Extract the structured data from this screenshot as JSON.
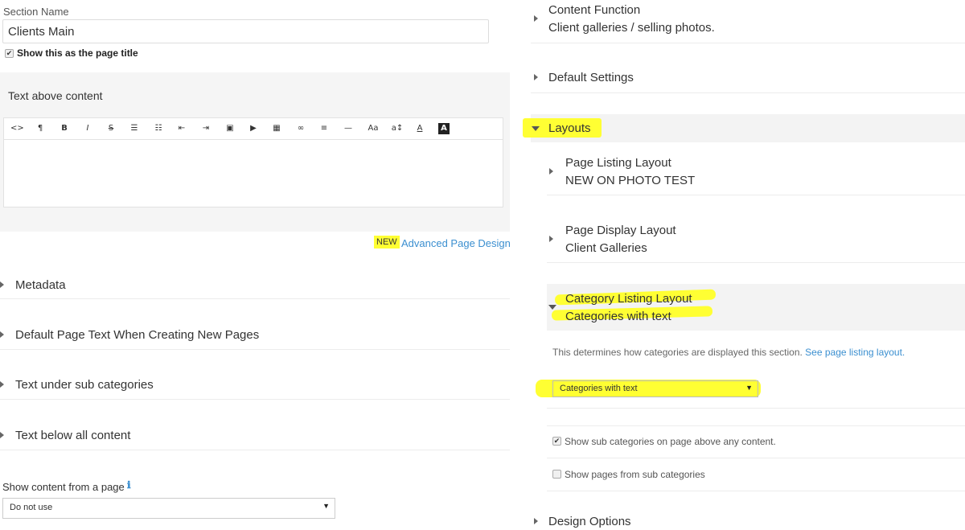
{
  "left": {
    "section_name_label": "Section Name",
    "section_name_value": "Clients Main",
    "show_title_label": "Show this as the page title",
    "text_above_label": "Text above content",
    "toolbar_icons": [
      "code-icon",
      "paragraph-icon",
      "bold-icon",
      "italic-icon",
      "strikethrough-icon",
      "bullet-list-icon",
      "numbered-list-icon",
      "outdent-icon",
      "indent-icon",
      "image-icon",
      "video-icon",
      "table-icon",
      "link-icon",
      "align-icon",
      "horizontal-rule-icon",
      "font-size-icon",
      "line-height-icon",
      "font-color-icon",
      "highlight-icon"
    ],
    "toolbar_glyphs": [
      "<>",
      "¶",
      "B",
      "I",
      "S",
      "☰",
      "☷",
      "⇤",
      "⇥",
      "▣",
      "▶",
      "▦",
      "∞",
      "≡",
      "—",
      "Aa",
      "a↕",
      "A",
      "A"
    ],
    "new_badge": "NEW",
    "advanced_link": "Advanced Page Design",
    "sections": [
      "Metadata",
      "Default Page Text When Creating New Pages",
      "Text under sub categories",
      "Text below all content"
    ],
    "show_content_label": "Show content from a page",
    "show_content_value": "Do not use",
    "info_icon": "ℹ"
  },
  "right": {
    "content_function_title": "Content Function",
    "content_function_value": "Client galleries / selling photos.",
    "default_settings": "Default Settings",
    "layouts": "Layouts",
    "page_listing_title": "Page Listing Layout",
    "page_listing_value": "NEW ON PHOTO TEST",
    "page_display_title": "Page Display Layout",
    "page_display_value": "Client Galleries",
    "category_listing_title": "Category Listing Layout",
    "category_listing_value": "Categories with text",
    "help_text": "This determines how categories are displayed this section.",
    "help_link": "See page listing layout.",
    "category_select_value": "Categories with text",
    "show_sub_categories": "Show sub categories on page above any content.",
    "show_pages_sub": "Show pages from sub categories",
    "design_options": "Design Options"
  },
  "colors": {
    "highlight": "#ffff33",
    "link": "#3b8fd0"
  }
}
